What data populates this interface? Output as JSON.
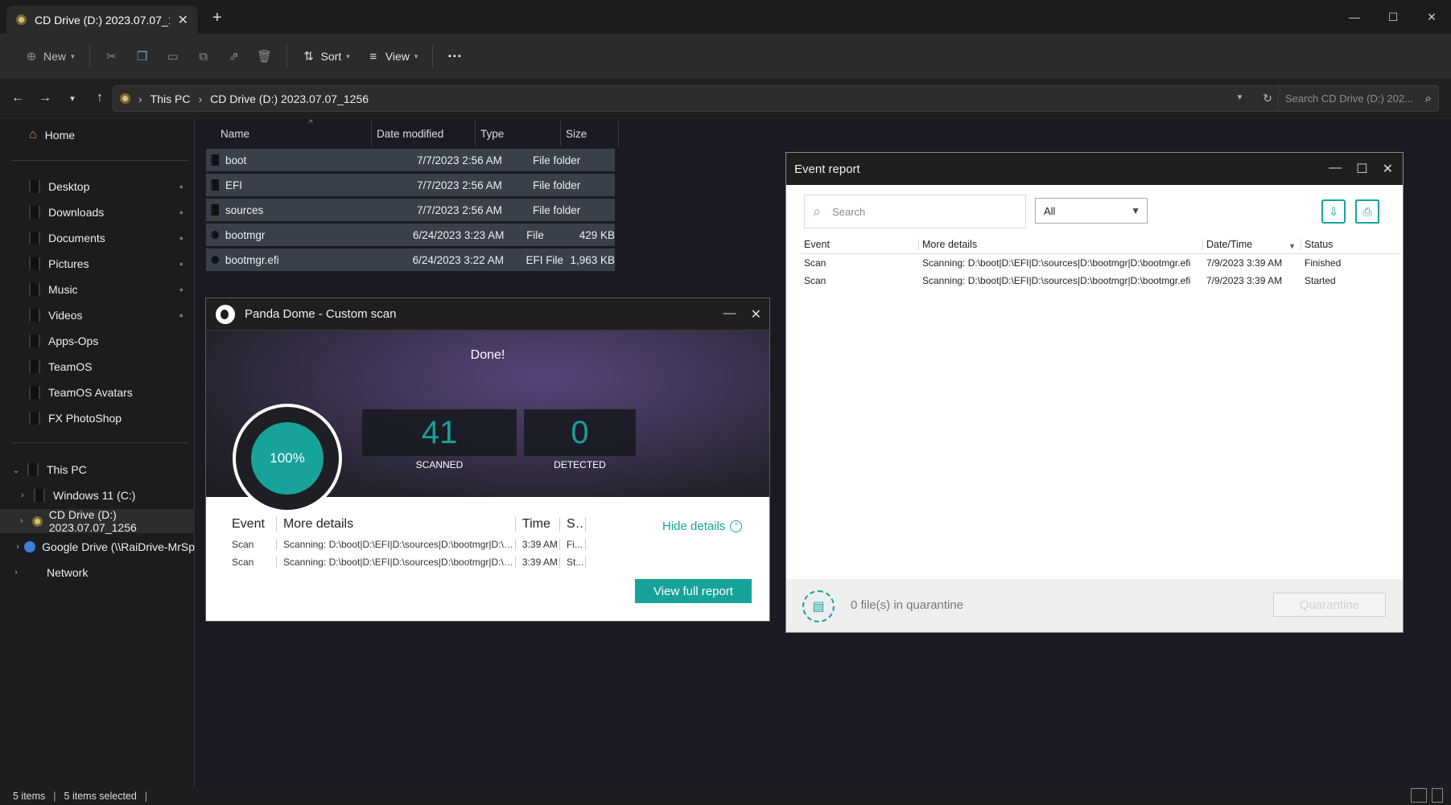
{
  "explorer": {
    "tab_title": "CD Drive (D:) 2023.07.07_1",
    "tab_close": "✕",
    "new_tab": "+",
    "window_controls": {
      "minimize": "—",
      "maximize": "☐",
      "close": "✕"
    },
    "toolbar": {
      "new_label": "New",
      "sort_label": "Sort",
      "view_label": "View",
      "more_label": "···"
    },
    "breadcrumb": {
      "root": "This PC",
      "current": "CD Drive (D:) 2023.07.07_1256"
    },
    "search_placeholder": "Search CD Drive (D:) 202...",
    "sidebar": {
      "home": "Home",
      "pinned": [
        "Desktop",
        "Downloads",
        "Documents",
        "Pictures",
        "Music",
        "Videos",
        "Apps-Ops",
        "TeamOS",
        "TeamOS Avatars",
        "FX PhotoShop"
      ],
      "this_pc": "This PC",
      "drives": [
        "Windows 11 (C:)",
        "CD Drive (D:) 2023.07.07_1256",
        "Google Drive (\\\\RaiDrive-MrSp"
      ],
      "network": "Network"
    },
    "columns": {
      "name": "Name",
      "date": "Date modified",
      "type": "Type",
      "size": "Size"
    },
    "files": [
      {
        "name": "boot",
        "date": "7/7/2023 2:56 AM",
        "type": "File folder",
        "size": ""
      },
      {
        "name": "EFI",
        "date": "7/7/2023 2:56 AM",
        "type": "File folder",
        "size": ""
      },
      {
        "name": "sources",
        "date": "7/7/2023 2:56 AM",
        "type": "File folder",
        "size": ""
      },
      {
        "name": "bootmgr",
        "date": "6/24/2023 3:23 AM",
        "type": "File",
        "size": "429 KB"
      },
      {
        "name": "bootmgr.efi",
        "date": "6/24/2023 3:22 AM",
        "type": "EFI File",
        "size": "1,963 KB"
      }
    ],
    "status": {
      "items": "5 items",
      "selected": "5 items selected"
    }
  },
  "panda": {
    "title": "Panda Dome - Custom scan",
    "done": "Done!",
    "progress_label": "100%",
    "progress": 1.0,
    "scanned_value": "41",
    "scanned_label": "SCANNED",
    "detected_value": "0",
    "detected_label": "DETECTED",
    "table_head": {
      "event": "Event",
      "details": "More details",
      "time": "Time",
      "status": "S..."
    },
    "rows": [
      {
        "event": "Scan",
        "details": "Scanning: D:\\boot|D:\\EFI|D:\\sources|D:\\bootmgr|D:\\boot...",
        "time": "3:39 AM",
        "status": "Fi..."
      },
      {
        "event": "Scan",
        "details": "Scanning: D:\\boot|D:\\EFI|D:\\sources|D:\\bootmgr|D:\\boot...",
        "time": "3:39 AM",
        "status": "St..."
      }
    ],
    "hide_details": "Hide details",
    "view_full_report": "View full report",
    "accent": "#17a39a"
  },
  "event_report": {
    "title": "Event report",
    "search_placeholder": "Search",
    "filter_value": "All",
    "columns": {
      "event": "Event",
      "details": "More details",
      "datetime": "Date/Time",
      "status": "Status"
    },
    "rows": [
      {
        "event": "Scan",
        "details": "Scanning: D:\\boot|D:\\EFI|D:\\sources|D:\\bootmgr|D:\\bootmgr.efi",
        "datetime": "7/9/2023 3:39 AM",
        "status": "Finished"
      },
      {
        "event": "Scan",
        "details": "Scanning: D:\\boot|D:\\EFI|D:\\sources|D:\\bootmgr|D:\\bootmgr.efi",
        "datetime": "7/9/2023 3:39 AM",
        "status": "Started"
      }
    ],
    "quarantine_text": "0 file(s) in quarantine",
    "quarantine_button": "Quarantine"
  }
}
